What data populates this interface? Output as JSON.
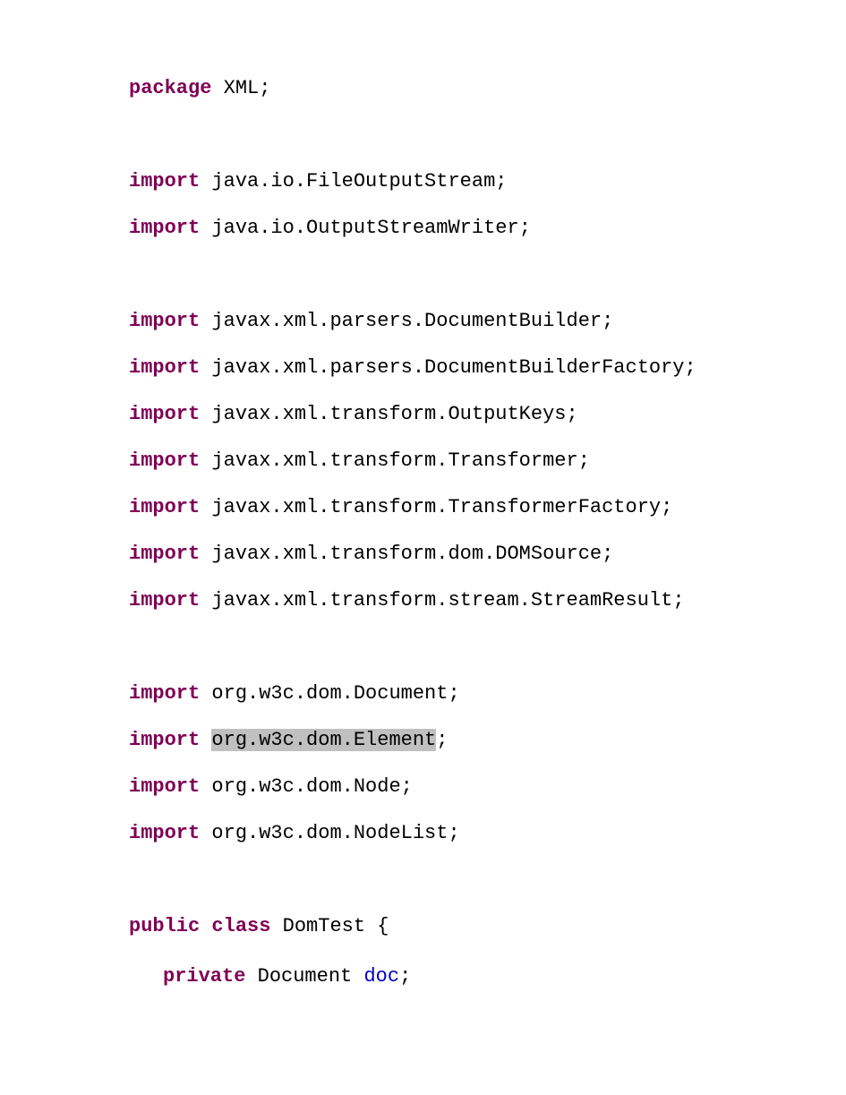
{
  "code": {
    "kw_package": "package",
    "kw_import": "import",
    "kw_public": "public",
    "kw_class": "class",
    "kw_private": "private",
    "package_name": "XML",
    "imports_a": [
      "java.io.FileOutputStream",
      "java.io.OutputStreamWriter"
    ],
    "imports_b": [
      "javax.xml.parsers.DocumentBuilder",
      "javax.xml.parsers.DocumentBuilderFactory",
      "javax.xml.transform.OutputKeys",
      "javax.xml.transform.Transformer",
      "javax.xml.transform.TransformerFactory",
      "javax.xml.transform.dom.DOMSource",
      "javax.xml.transform.stream.StreamResult"
    ],
    "imports_c": [
      "org.w3c.dom.Document",
      "org.w3c.dom.Element",
      "org.w3c.dom.Node",
      "org.w3c.dom.NodeList"
    ],
    "highlighted_import_index": 1,
    "class_name": "DomTest",
    "field_type": "Document",
    "field_name": "doc",
    "semicolon": ";",
    "open_brace": "{",
    "space": " "
  }
}
